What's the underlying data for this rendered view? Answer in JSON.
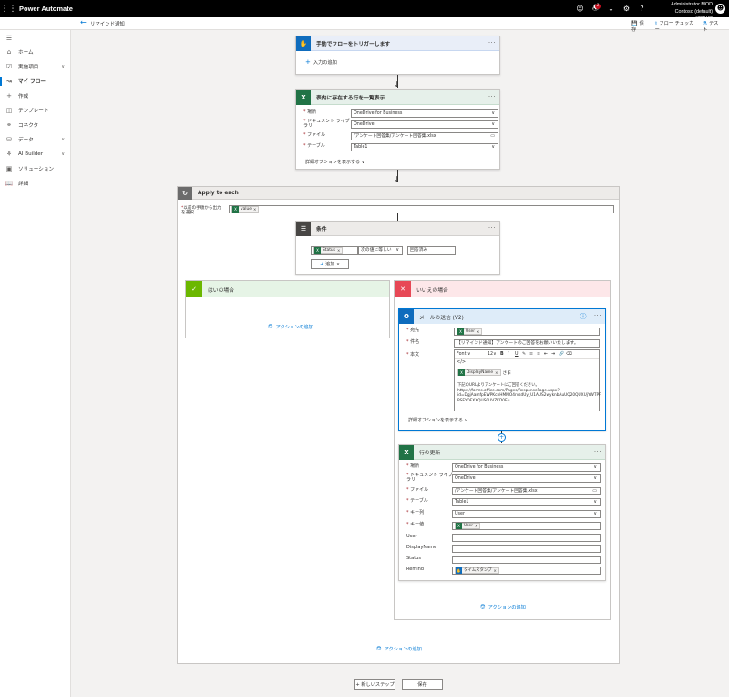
{
  "app": {
    "title": "Power Automate"
  },
  "topbar": {
    "user_name": "Administrator MOD",
    "tenant": "Contoso (default) (org038",
    "notification_count": "1",
    "icons": [
      "smiley-icon",
      "bell-icon",
      "download-icon",
      "gear-icon",
      "help-icon"
    ]
  },
  "cmdbar": {
    "breadcrumb": "リマインド通知",
    "save": "保存",
    "flow_checker": "フロー チェッカー",
    "test": "テスト"
  },
  "sidebar": {
    "items": [
      {
        "label": "ホーム",
        "icon": "home-icon"
      },
      {
        "label": "実施項目",
        "icon": "checklist-icon"
      },
      {
        "label": "マイ フロー",
        "icon": "flow-icon"
      },
      {
        "label": "作成",
        "icon": "plus-icon"
      },
      {
        "label": "テンプレート",
        "icon": "template-icon"
      },
      {
        "label": "コネクタ",
        "icon": "connector-icon"
      },
      {
        "label": "データ",
        "icon": "database-icon"
      },
      {
        "label": "AI Builder",
        "icon": "ai-icon"
      },
      {
        "label": "ソリューション",
        "icon": "solution-icon"
      },
      {
        "label": "詳細",
        "icon": "book-icon"
      }
    ]
  },
  "trigger": {
    "title": "手動でフローをトリガーします",
    "add_input": "入力の追加"
  },
  "list_rows": {
    "title": "表内に存在する行を一覧表示",
    "location_label": "場所",
    "location_value": "OneDrive for Business",
    "library_label": "ドキュメント ライブラリ",
    "library_value": "OneDrive",
    "file_label": "ファイル",
    "file_value": "/アンケート回答集/アンケート回答集.xlsx",
    "table_label": "テーブル",
    "table_value": "Table1",
    "advanced": "詳細オプションを表示する"
  },
  "apply_each": {
    "title": "Apply to each",
    "select_label": "以前の手順から出力を選択",
    "token": "value"
  },
  "condition": {
    "title": "条件",
    "token": "Status",
    "operator": "次の値に等しい",
    "value": "回答済み",
    "add": "追加"
  },
  "branch_yes": {
    "title": "はいの場合",
    "add_action": "アクションの追加"
  },
  "branch_no": {
    "title": "いいえの場合",
    "add_action": "アクションの追加"
  },
  "send_mail": {
    "title": "メールの送信 (V2)",
    "to_label": "宛先",
    "to_token": "User",
    "subject_label": "件名",
    "subject_value": "【リマインド通知】アンケートのご回答をお願いいたします。",
    "body_label": "本文",
    "font": "Font",
    "font_size": "12",
    "body_token": "DisplayName",
    "body_suffix": "さま",
    "body_line1": "下記のURLよりアンケートにご回答ください。",
    "body_line2": "https://forms.office.com/Pages/ResponsePage.aspx?",
    "body_line3": "id=DgjAamfpEWPKcnHMMO4rvsdUy_U1AUS2wyknbAuUQ20QUXUjYWTPF",
    "body_line4": "PSEYOFXXQUS0UVZKD0Eu",
    "advanced": "詳細オプションを表示する"
  },
  "update_row": {
    "title": "行の更新",
    "location_label": "場所",
    "location_value": "OneDrive for Business",
    "library_label": "ドキュメント ライブラリ",
    "library_value": "OneDrive",
    "file_label": "ファイル",
    "file_value": "/アンケート回答集/アンケート回答集.xlsx",
    "table_label": "テーブル",
    "table_value": "Table1",
    "keycol_label": "キー列",
    "keycol_value": "User",
    "keyval_label": "キー値",
    "keyval_token": "User",
    "user_label": "User",
    "displayname_label": "DisplayName",
    "status_label": "Status",
    "remind_label": "Remind",
    "remind_token": "タイムスタンプ",
    "add_action": "アクションの追加"
  },
  "loop_add_action": "アクションの追加",
  "footer": {
    "new_step": "+ 新しいステップ",
    "save": "保存"
  }
}
